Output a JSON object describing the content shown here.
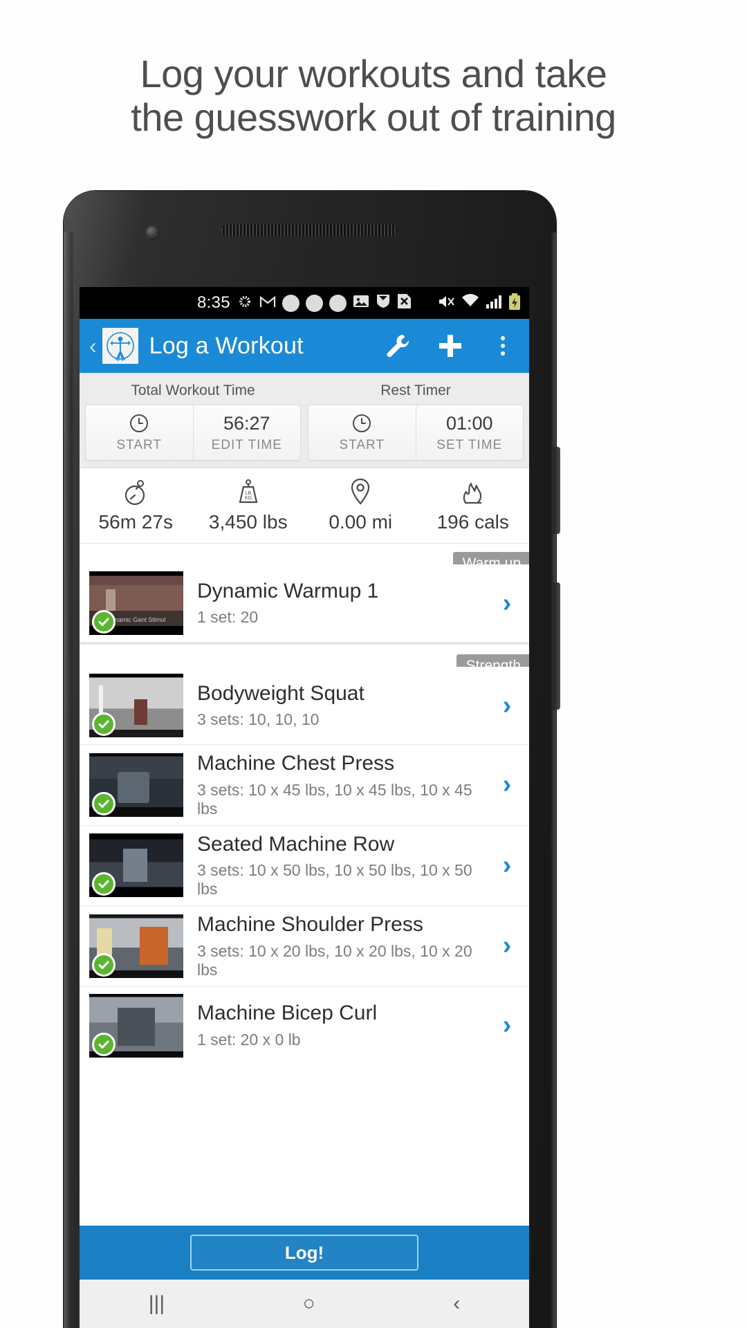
{
  "headline": {
    "line1": "Log your workouts and take",
    "line2": "the guesswork out of training"
  },
  "status_bar": {
    "time": "8:35",
    "left_icons": [
      "sun-icon",
      "gmail-icon",
      "dot-icon",
      "dot-icon",
      "dot-icon",
      "photo-icon",
      "shield-icon",
      "x-file-icon"
    ],
    "right_icons": [
      "mute-icon",
      "wifi-icon",
      "signal-icon",
      "battery-icon"
    ]
  },
  "toolbar": {
    "back": "‹",
    "logo": "vitruvian-man-icon",
    "title": "Log a Workout",
    "wrench": "wrench-icon",
    "plus": "+",
    "overflow": "kebab-menu-icon"
  },
  "timers": [
    {
      "label": "Total Workout Time",
      "start_icon": "clock-icon",
      "start_label": "START",
      "value": "56:27",
      "value_sub": "EDIT TIME"
    },
    {
      "label": "Rest Timer",
      "start_icon": "clock-icon",
      "start_label": "START",
      "value": "01:00",
      "value_sub": "SET TIME"
    }
  ],
  "stats": [
    {
      "icon": "stopwatch-icon",
      "value": "56m 27s"
    },
    {
      "icon": "weight-plate-icon",
      "value": "3,450 lbs"
    },
    {
      "icon": "location-pin-icon",
      "value": "0.00 mi"
    },
    {
      "icon": "flame-icon",
      "value": "196 cals"
    }
  ],
  "groups": [
    {
      "tag": "Warm up",
      "exercises": [
        {
          "title": "Dynamic Warmup 1",
          "sets": "1 set: 20",
          "completed": true,
          "thumb_caption": "Dynamic Gant Stimul",
          "chevron": "›"
        }
      ]
    },
    {
      "tag": "Strength",
      "exercises": [
        {
          "title": "Bodyweight Squat",
          "sets": "3 sets: 10, 10, 10",
          "completed": true,
          "thumb_caption": "",
          "chevron": "›"
        },
        {
          "title": "Machine Chest Press",
          "sets": "3 sets: 10 x 45 lbs, 10 x 45 lbs, 10 x 45 lbs",
          "completed": true,
          "thumb_caption": "",
          "chevron": "›"
        },
        {
          "title": "Seated Machine Row",
          "sets": "3 sets: 10 x 50 lbs, 10 x 50 lbs, 10 x 50 lbs",
          "completed": true,
          "thumb_caption": "",
          "chevron": "›"
        },
        {
          "title": "Machine Shoulder Press",
          "sets": "3 sets: 10 x 20 lbs, 10 x 20 lbs, 10 x 20 lbs",
          "completed": true,
          "thumb_caption": "",
          "chevron": "›"
        },
        {
          "title": "Machine Bicep Curl",
          "sets": "1 set: 20 x 0 lb",
          "completed": true,
          "thumb_caption": "",
          "chevron": "›"
        }
      ]
    }
  ],
  "bottom_bar": {
    "log_label": "Log!"
  },
  "nav_bar": {
    "recents": "|||",
    "home": "○",
    "back": "‹"
  },
  "colors": {
    "accent_blue": "#1b8ad6",
    "bar_blue": "#1b7fc4",
    "check_green": "#5cb531",
    "tag_gray": "#9a9a9a"
  }
}
